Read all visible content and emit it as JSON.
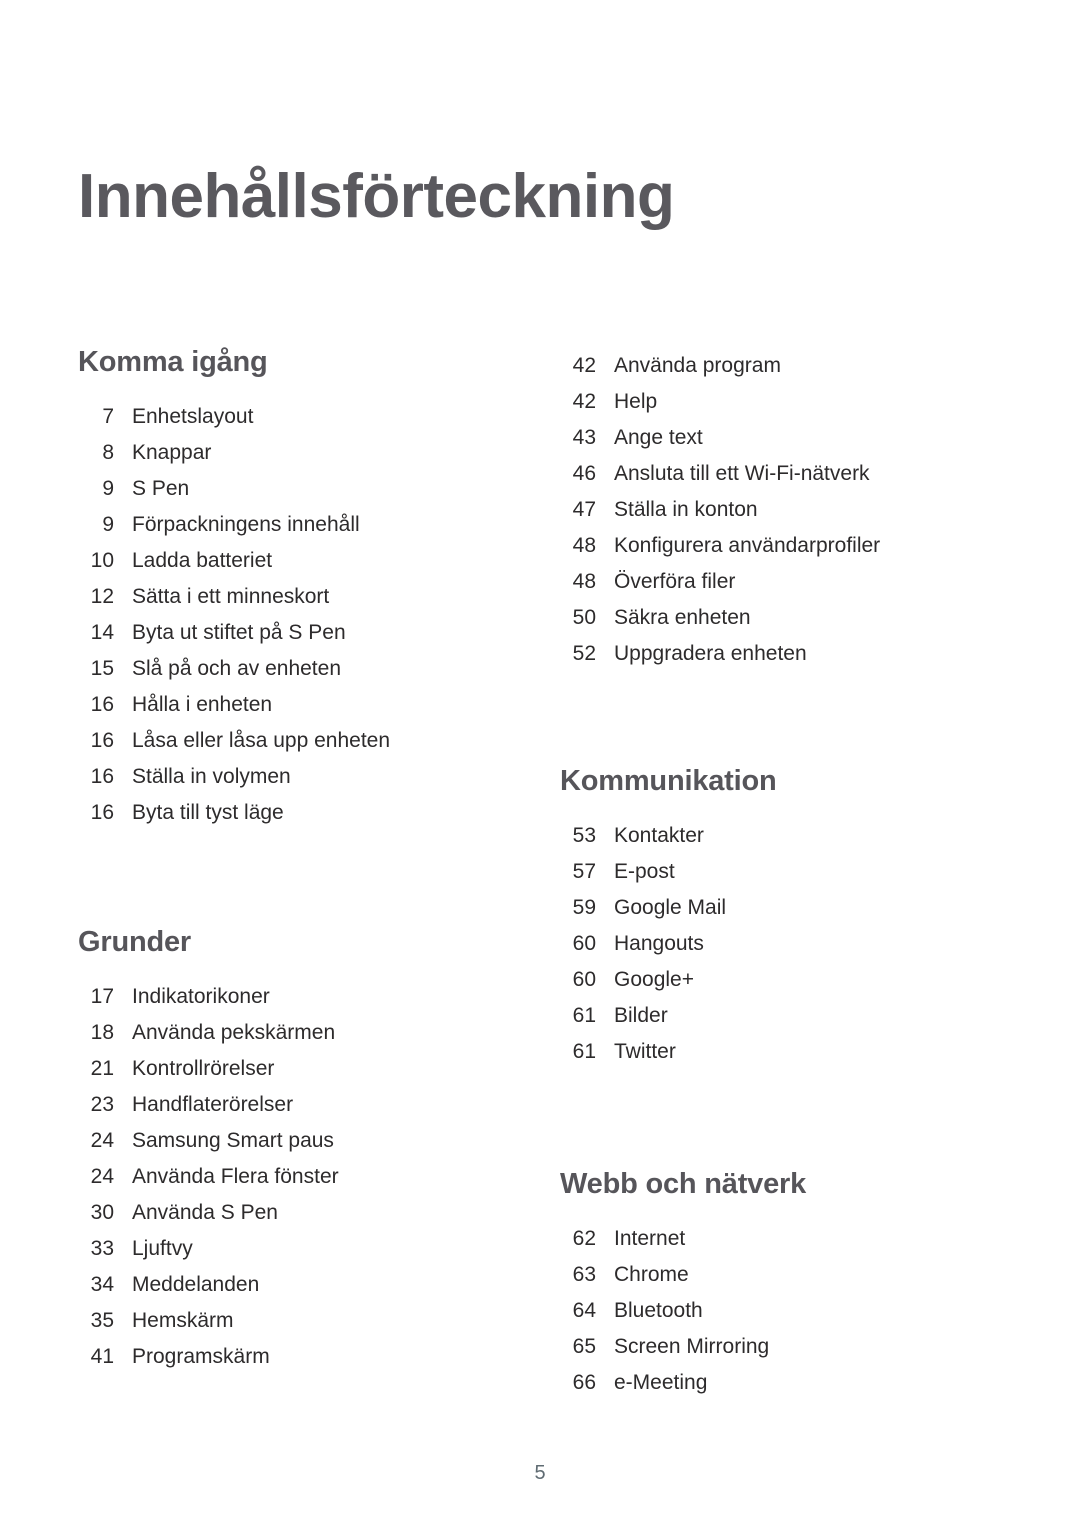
{
  "document": {
    "title": "Innehållsförteckning",
    "page_number": "5",
    "title_color": "#5a595e",
    "heading_color": "#56555a",
    "body_color": "#2d2b2c",
    "page_number_color": "#5f6b72",
    "background_color": "#ffffff"
  },
  "columns": {
    "left": {
      "sections": [
        {
          "heading": "Komma igång",
          "entries": [
            {
              "page": "7",
              "label": "Enhetslayout"
            },
            {
              "page": "8",
              "label": "Knappar"
            },
            {
              "page": "9",
              "label": "S Pen"
            },
            {
              "page": "9",
              "label": "Förpackningens innehåll"
            },
            {
              "page": "10",
              "label": "Ladda batteriet"
            },
            {
              "page": "12",
              "label": "Sätta i ett minneskort"
            },
            {
              "page": "14",
              "label": "Byta ut stiftet på S Pen"
            },
            {
              "page": "15",
              "label": "Slå på och av enheten"
            },
            {
              "page": "16",
              "label": "Hålla i enheten"
            },
            {
              "page": "16",
              "label": "Låsa eller låsa upp enheten"
            },
            {
              "page": "16",
              "label": "Ställa in volymen"
            },
            {
              "page": "16",
              "label": "Byta till tyst läge"
            }
          ]
        },
        {
          "heading": "Grunder",
          "entries": [
            {
              "page": "17",
              "label": "Indikatorikoner"
            },
            {
              "page": "18",
              "label": "Använda pekskärmen"
            },
            {
              "page": "21",
              "label": "Kontrollrörelser"
            },
            {
              "page": "23",
              "label": "Handflaterörelser"
            },
            {
              "page": "24",
              "label": "Samsung Smart paus"
            },
            {
              "page": "24",
              "label": "Använda Flera fönster"
            },
            {
              "page": "30",
              "label": "Använda S Pen"
            },
            {
              "page": "33",
              "label": "Ljuftvy"
            },
            {
              "page": "34",
              "label": "Meddelanden"
            },
            {
              "page": "35",
              "label": "Hemskärm"
            },
            {
              "page": "41",
              "label": "Programskärm"
            }
          ]
        }
      ]
    },
    "right": {
      "sections": [
        {
          "heading": "",
          "entries": [
            {
              "page": "42",
              "label": "Använda program"
            },
            {
              "page": "42",
              "label": "Help"
            },
            {
              "page": "43",
              "label": "Ange text"
            },
            {
              "page": "46",
              "label": "Ansluta till ett Wi-Fi-nätverk"
            },
            {
              "page": "47",
              "label": "Ställa in konton"
            },
            {
              "page": "48",
              "label": "Konfigurera användarprofiler"
            },
            {
              "page": "48",
              "label": "Överföra filer"
            },
            {
              "page": "50",
              "label": "Säkra enheten"
            },
            {
              "page": "52",
              "label": "Uppgradera enheten"
            }
          ]
        },
        {
          "heading": "Kommunikation",
          "entries": [
            {
              "page": "53",
              "label": "Kontakter"
            },
            {
              "page": "57",
              "label": "E-post"
            },
            {
              "page": "59",
              "label": "Google Mail"
            },
            {
              "page": "60",
              "label": "Hangouts"
            },
            {
              "page": "60",
              "label": "Google+"
            },
            {
              "page": "61",
              "label": "Bilder"
            },
            {
              "page": "61",
              "label": "Twitter"
            }
          ]
        },
        {
          "heading": "Webb och nätverk",
          "entries": [
            {
              "page": "62",
              "label": "Internet"
            },
            {
              "page": "63",
              "label": "Chrome"
            },
            {
              "page": "64",
              "label": "Bluetooth"
            },
            {
              "page": "65",
              "label": "Screen Mirroring"
            },
            {
              "page": "66",
              "label": "e-Meeting"
            }
          ]
        }
      ]
    }
  }
}
